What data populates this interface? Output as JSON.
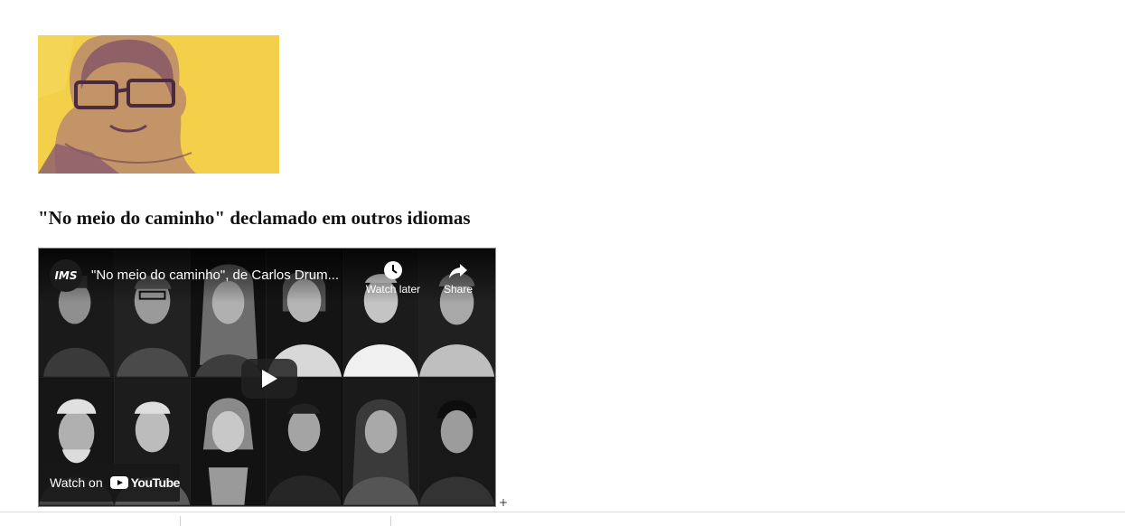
{
  "article": {
    "heading": "\"No meio do caminho\" declamado em outros idiomas"
  },
  "video": {
    "channel_logo_text": "IMS",
    "title": "\"No meio do caminho\", de Carlos Drum...",
    "watch_later_label": "Watch later",
    "share_label": "Share",
    "watch_on_label": "Watch on",
    "youtube_label": "YouTube"
  },
  "resize_handle": "+",
  "colors": {
    "portrait_background": "#f3cf4a",
    "portrait_ink": "#8a5a6e",
    "video_background": "#000000"
  },
  "icons": [
    "play-icon",
    "clock-icon",
    "share-arrow-icon",
    "youtube-logo-icon"
  ]
}
